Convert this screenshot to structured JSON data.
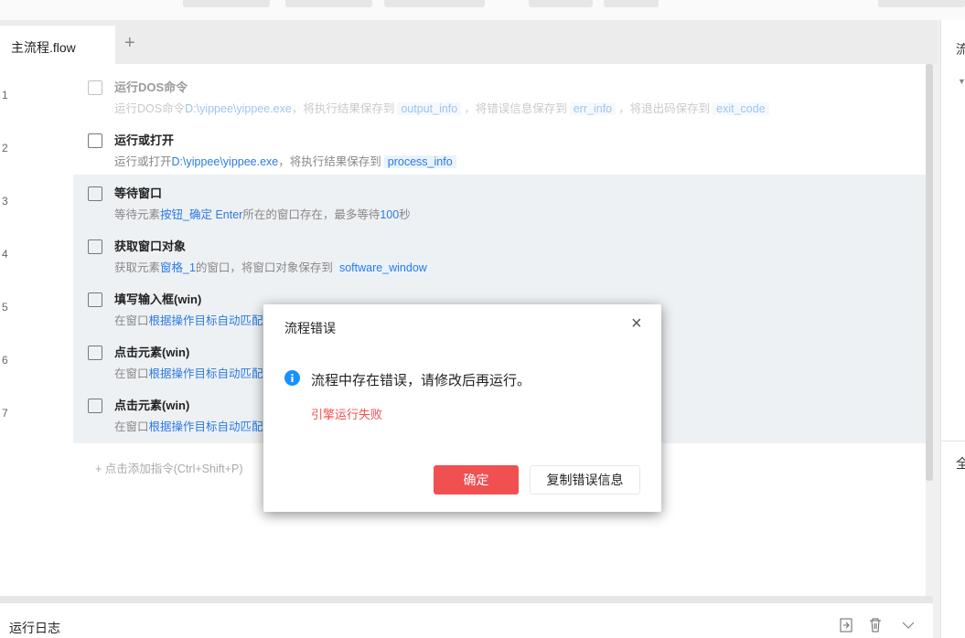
{
  "tabs": {
    "active": "主流程.flow",
    "add": "+"
  },
  "rows": [
    {
      "num": "1",
      "title": "运行DOS命令",
      "parts": [
        "运行DOS命令",
        "D:\\yippee\\yippee.exe",
        "，将执行结果保存到",
        "output_info",
        "，将错误信息保存到",
        "err_info",
        "，将退出码保存到",
        "exit_code"
      ]
    },
    {
      "num": "2",
      "title": "运行或打开",
      "parts": [
        "运行或打开",
        "D:\\yippee\\yippee.exe",
        "，将执行结果保存到",
        "process_info"
      ]
    },
    {
      "num": "3",
      "title": "等待窗口",
      "parts": [
        "等待元素",
        "按钮_确定 Enter",
        "所在的窗口存在，最多等待",
        "100",
        "秒"
      ]
    },
    {
      "num": "4",
      "title": "获取窗口对象",
      "parts": [
        "获取元素",
        "窗格_1",
        "的窗口，将窗口对象保存到",
        "software_window"
      ]
    },
    {
      "num": "5",
      "title": "填写输入框(win)",
      "parts": [
        "在窗口",
        "根据操作目标自动匹配"
      ]
    },
    {
      "num": "6",
      "title": "点击元素(win)",
      "parts": [
        "在窗口",
        "根据操作目标自动匹配"
      ]
    },
    {
      "num": "7",
      "title": "点击元素(win)",
      "parts": [
        "在窗口",
        "根据操作目标自动匹配"
      ]
    }
  ],
  "add_command": "+  点击添加指令(Ctrl+Shift+P)",
  "right_panel": {
    "title": "流",
    "section": "全"
  },
  "log": {
    "title": "运行日志"
  },
  "dialog": {
    "title": "流程错误",
    "message": "流程中存在错误，请修改后再运行。",
    "detail": "引擎运行失败",
    "confirm": "确定",
    "copy": "复制错误信息"
  },
  "colors": {
    "accent": "#2a7ae2",
    "danger": "#f05050",
    "info": "#1890ff"
  }
}
